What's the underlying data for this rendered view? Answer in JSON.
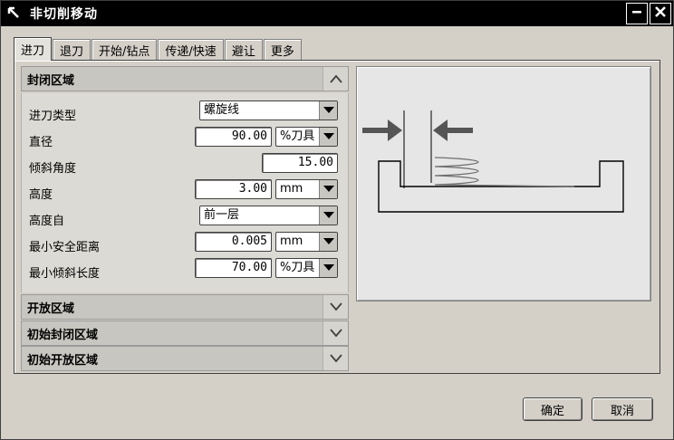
{
  "window": {
    "title": "非切削移动"
  },
  "tabs": [
    {
      "label": "进刀"
    },
    {
      "label": "退刀"
    },
    {
      "label": "开始/钻点"
    },
    {
      "label": "传递/快速"
    },
    {
      "label": "避让"
    },
    {
      "label": "更多"
    }
  ],
  "sections": {
    "closed": {
      "title": "封闭区域"
    },
    "open": {
      "title": "开放区域"
    },
    "initial_closed": {
      "title": "初始封闭区域"
    },
    "initial_open": {
      "title": "初始开放区域"
    }
  },
  "params": {
    "entry_type": {
      "label": "进刀类型",
      "value": "螺旋线"
    },
    "diameter": {
      "label": "直径",
      "value": "90.00",
      "unit": "%刀具"
    },
    "ramp_angle": {
      "label": "倾斜角度",
      "value": "15.00"
    },
    "height": {
      "label": "高度",
      "value": "3.00",
      "unit": "mm"
    },
    "height_from": {
      "label": "高度自",
      "value": "前一层"
    },
    "min_clearance": {
      "label": "最小安全距离",
      "value": "0.005",
      "unit": "mm"
    },
    "min_ramp_length": {
      "label": "最小倾斜长度",
      "value": "70.00",
      "unit": "%刀具"
    }
  },
  "buttons": {
    "ok": "确定",
    "cancel": "取消"
  },
  "icons": {
    "title": "cursor-arrow-icon",
    "minimize": "minimize-icon",
    "close": "close-icon",
    "collapse": "chevron-up-icon",
    "expand": "chevron-down-icon",
    "dropdown": "dropdown-arrow-icon"
  }
}
